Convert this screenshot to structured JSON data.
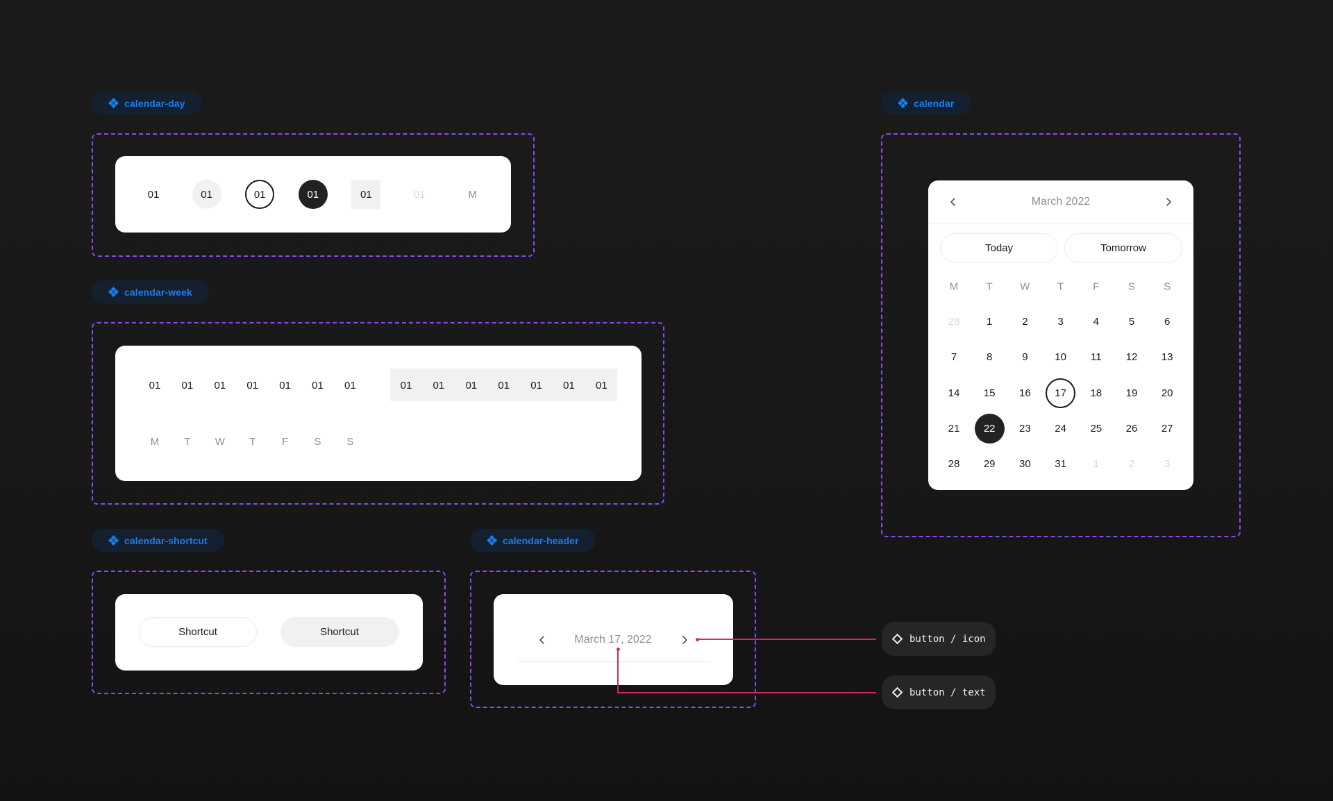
{
  "labels": {
    "calendar_day": "calendar-day",
    "calendar_week": "calendar-week",
    "calendar_shortcut": "calendar-shortcut",
    "calendar_header": "calendar-header",
    "calendar": "calendar"
  },
  "calendar_day": {
    "cells": [
      {
        "text": "01",
        "state": "default"
      },
      {
        "text": "01",
        "state": "hover"
      },
      {
        "text": "01",
        "state": "today"
      },
      {
        "text": "01",
        "state": "selected"
      },
      {
        "text": "01",
        "state": "range"
      },
      {
        "text": "01",
        "state": "disabled"
      },
      {
        "text": "M",
        "state": "weekday"
      }
    ]
  },
  "calendar_week": {
    "default_days": [
      "01",
      "01",
      "01",
      "01",
      "01",
      "01",
      "01"
    ],
    "range_days": [
      "01",
      "01",
      "01",
      "01",
      "01",
      "01",
      "01"
    ],
    "weekdays": [
      "M",
      "T",
      "W",
      "T",
      "F",
      "S",
      "S"
    ]
  },
  "calendar_shortcut": {
    "buttons": [
      "Shortcut",
      "Shortcut"
    ]
  },
  "calendar_header": {
    "title": "March 17, 2022",
    "prev_icon": "chevron-left-icon",
    "next_icon": "chevron-right-icon"
  },
  "annotations": [
    {
      "label": "button / icon"
    },
    {
      "label": "button / text"
    }
  ],
  "calendar": {
    "month_title": "March 2022",
    "shortcuts": [
      "Today",
      "Tomorrow"
    ],
    "weekdays": [
      "M",
      "T",
      "W",
      "T",
      "F",
      "S",
      "S"
    ],
    "today": "17",
    "selected": "22",
    "weeks": [
      [
        {
          "d": "28",
          "o": true
        },
        {
          "d": "1"
        },
        {
          "d": "2"
        },
        {
          "d": "3"
        },
        {
          "d": "4"
        },
        {
          "d": "5"
        },
        {
          "d": "6"
        }
      ],
      [
        {
          "d": "7"
        },
        {
          "d": "8"
        },
        {
          "d": "9"
        },
        {
          "d": "10"
        },
        {
          "d": "11"
        },
        {
          "d": "12"
        },
        {
          "d": "13"
        }
      ],
      [
        {
          "d": "14"
        },
        {
          "d": "15"
        },
        {
          "d": "16"
        },
        {
          "d": "17"
        },
        {
          "d": "18"
        },
        {
          "d": "19"
        },
        {
          "d": "20"
        }
      ],
      [
        {
          "d": "21"
        },
        {
          "d": "22"
        },
        {
          "d": "23"
        },
        {
          "d": "24"
        },
        {
          "d": "25"
        },
        {
          "d": "26"
        },
        {
          "d": "27"
        }
      ],
      [
        {
          "d": "28"
        },
        {
          "d": "29"
        },
        {
          "d": "30"
        },
        {
          "d": "31"
        },
        {
          "d": "1",
          "o": true
        },
        {
          "d": "2",
          "o": true
        },
        {
          "d": "3",
          "o": true
        }
      ]
    ]
  },
  "colors": {
    "accent_blue": "#1b7cf2",
    "frame_purple": "#8a4af3",
    "annotation_red": "#d0285f",
    "selected_dark": "#222222"
  }
}
